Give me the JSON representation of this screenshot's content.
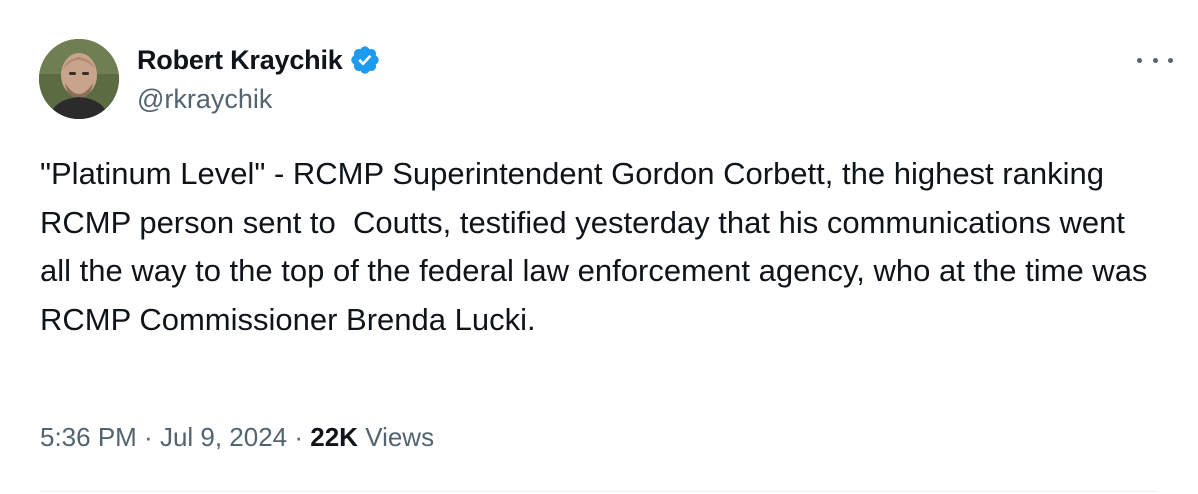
{
  "author": {
    "display_name": "Robert Kraychik",
    "handle": "@rkraychik",
    "verified": true,
    "avatar_icon": "user-avatar-photo"
  },
  "tweet": {
    "text": "\"Platinum Level\" - RCMP Superintendent Gordon Corbett, the highest ranking RCMP person sent to  Coutts, testified yesterday that his communications went all the way to the top of the federal law enforcement agency, who at the time was RCMP Commissioner Brenda Lucki."
  },
  "meta": {
    "time": "5:36 PM",
    "separator": " · ",
    "date": "Jul 9, 2024",
    "views_count": "22K",
    "views_label": " Views"
  },
  "colors": {
    "text_primary": "#0f1419",
    "text_secondary": "#536471",
    "verified_blue": "#1d9bf0",
    "divider": "#eff3f4"
  },
  "icons": {
    "verified": "verified-badge-icon",
    "more": "more-options-icon"
  }
}
